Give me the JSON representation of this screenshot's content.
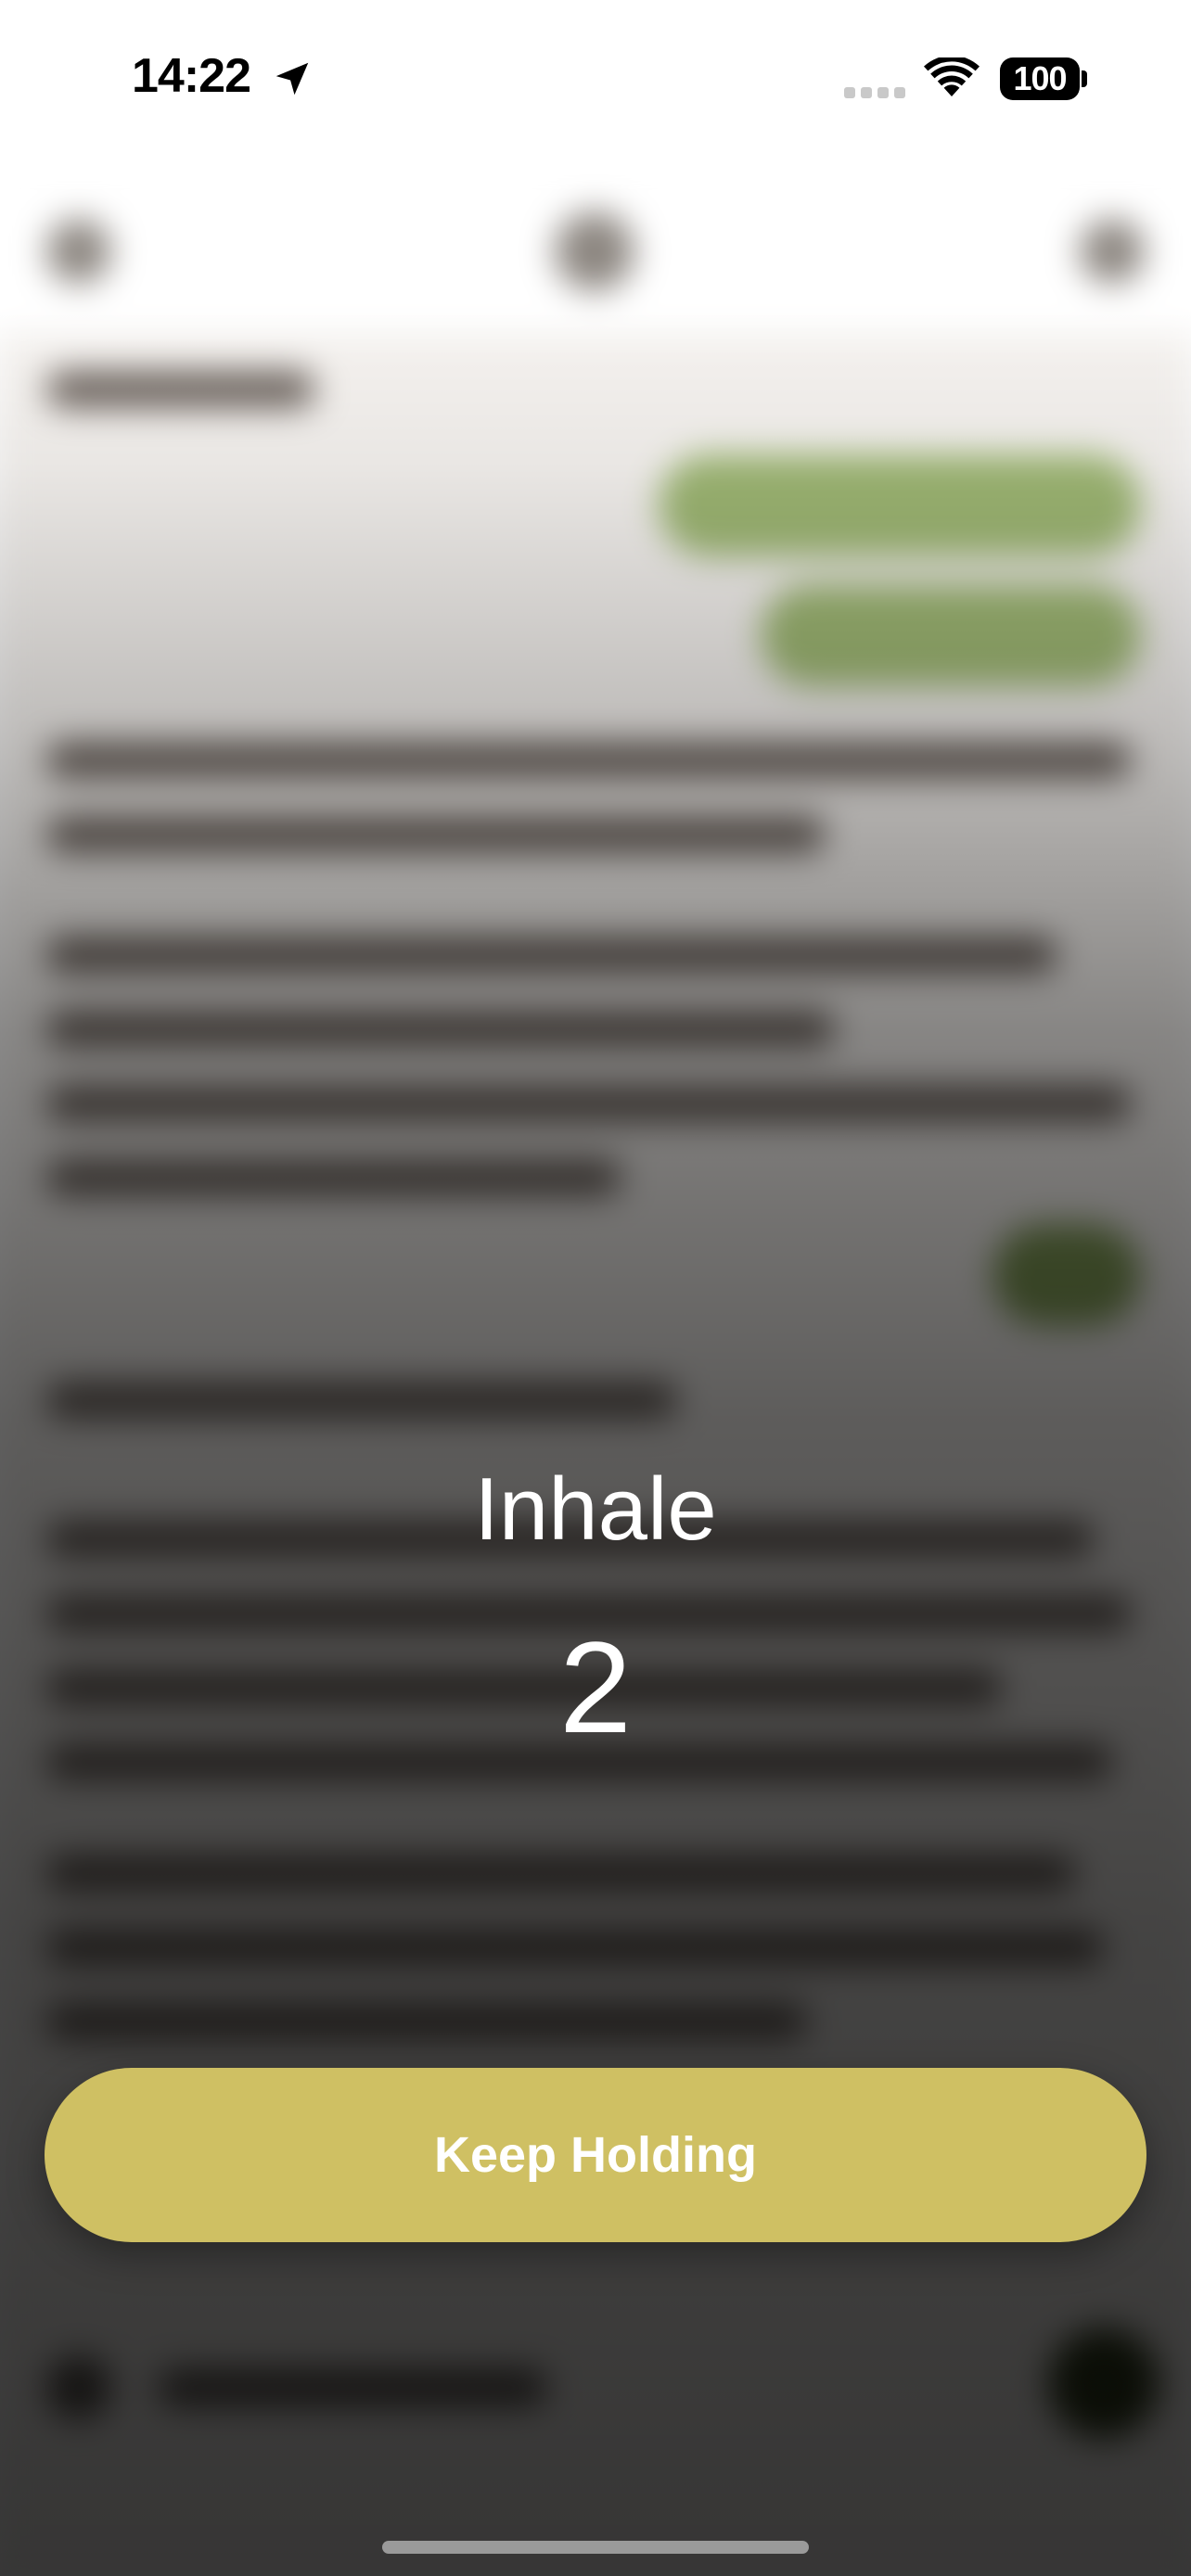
{
  "status_bar": {
    "time": "14:22",
    "battery": "100",
    "location_icon": "location-arrow-icon",
    "wifi_icon": "wifi-icon"
  },
  "breathing": {
    "phase": "Inhale",
    "count": "2",
    "button_label": "Keep Holding"
  },
  "colors": {
    "button": "#cfc063",
    "bubble": "#9fb874",
    "chat_background": "#f6f3f0"
  }
}
